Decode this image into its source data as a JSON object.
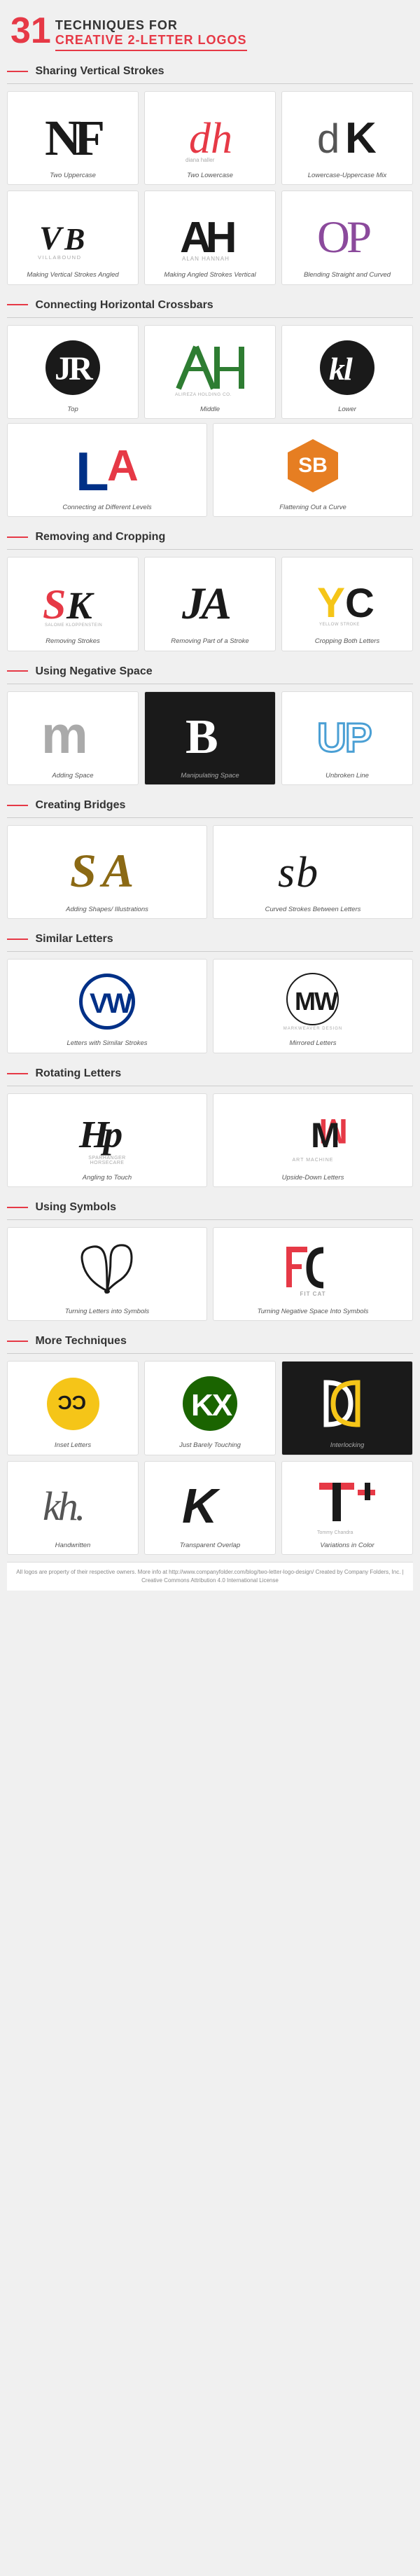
{
  "header": {
    "number": "31",
    "line1": "TECHNIQUES FOR",
    "line2": "CREATIVE 2-LETTER LOGOS"
  },
  "sections": [
    {
      "id": "sharing-vertical-strokes",
      "title": "Sharing Vertical Strokes",
      "items": [
        {
          "id": "two-uppercase",
          "label": "Two Uppercase",
          "dark": false
        },
        {
          "id": "two-lowercase",
          "label": "Two Lowercase",
          "dark": false
        },
        {
          "id": "lowercase-uppercase-mix",
          "label": "Lowercase-Uppercase Mix",
          "dark": false
        },
        {
          "id": "making-vertical-strokes-angled",
          "label": "Making Vertical Strokes Angled",
          "dark": false
        },
        {
          "id": "making-angled-strokes-vertical",
          "label": "Making Angled Strokes Vertical",
          "dark": false
        },
        {
          "id": "blending-straight-curved",
          "label": "Blending Straight and Curved",
          "dark": false
        }
      ]
    },
    {
      "id": "connecting-horizontal-crossbars",
      "title": "Connecting Horizontal Crossbars",
      "items": [
        {
          "id": "top",
          "label": "Top",
          "dark": false
        },
        {
          "id": "middle",
          "label": "Middle",
          "dark": false
        },
        {
          "id": "lower",
          "label": "Lower",
          "dark": false
        },
        {
          "id": "connecting-different-levels",
          "label": "Connecting at Different Levels",
          "dark": false
        },
        {
          "id": "flattening-out-curve",
          "label": "Flattening Out a Curve",
          "dark": false
        }
      ]
    },
    {
      "id": "removing-cropping",
      "title": "Removing and Cropping",
      "items": [
        {
          "id": "removing-strokes",
          "label": "Removing Strokes",
          "dark": false
        },
        {
          "id": "removing-part-stroke",
          "label": "Removing Part of a Stroke",
          "dark": false
        },
        {
          "id": "cropping-both-letters",
          "label": "Cropping Both Letters",
          "dark": false
        }
      ]
    },
    {
      "id": "negative-space",
      "title": "Using Negative Space",
      "items": [
        {
          "id": "adding-space",
          "label": "Adding Space",
          "dark": false
        },
        {
          "id": "manipulating-space",
          "label": "Manipulating Space",
          "dark": true
        },
        {
          "id": "unbroken-line",
          "label": "Unbroken Line",
          "dark": false
        }
      ]
    },
    {
      "id": "creating-bridges",
      "title": "Creating Bridges",
      "items": [
        {
          "id": "adding-shapes",
          "label": "Adding Shapes/ Illustrations",
          "dark": false
        },
        {
          "id": "curved-strokes",
          "label": "Curved Strokes Between Letters",
          "dark": false
        }
      ]
    },
    {
      "id": "similar-letters",
      "title": "Similar Letters",
      "items": [
        {
          "id": "similar-strokes",
          "label": "Letters with Similar Strokes",
          "dark": false
        },
        {
          "id": "mirrored-letters",
          "label": "Mirrored Letters",
          "dark": false
        }
      ]
    },
    {
      "id": "rotating-letters",
      "title": "Rotating Letters",
      "items": [
        {
          "id": "angling-to-touch",
          "label": "Angling to Touch",
          "dark": false
        },
        {
          "id": "upside-down-letters",
          "label": "Upside-Down Letters",
          "dark": false
        }
      ]
    },
    {
      "id": "using-symbols",
      "title": "Using Symbols",
      "items": [
        {
          "id": "turning-symbols",
          "label": "Turning Letters into Symbols",
          "dark": false
        },
        {
          "id": "turning-negative-space",
          "label": "Turning Negative Space Into Symbols",
          "dark": false
        }
      ]
    },
    {
      "id": "more-techniques",
      "title": "More Techniques",
      "items": [
        {
          "id": "inset-letters",
          "label": "Inset Letters",
          "dark": false
        },
        {
          "id": "just-barely-touching",
          "label": "Just Barely Touching",
          "dark": false
        },
        {
          "id": "interlocking",
          "label": "Interlocking",
          "dark": true
        },
        {
          "id": "handwritten",
          "label": "Handwritten",
          "dark": false
        },
        {
          "id": "transparent-overlap",
          "label": "Transparent Overlap",
          "dark": false
        },
        {
          "id": "variations-in-color",
          "label": "Variations in Color",
          "dark": false
        }
      ]
    }
  ],
  "footer": {
    "text": "All logos are property of their respective owners. More info at http://www.companyfolder.com/blog/two-letter-logo-design/ Created by Company Folders, Inc. | Creative Commons Attribution 4.0 International License"
  }
}
